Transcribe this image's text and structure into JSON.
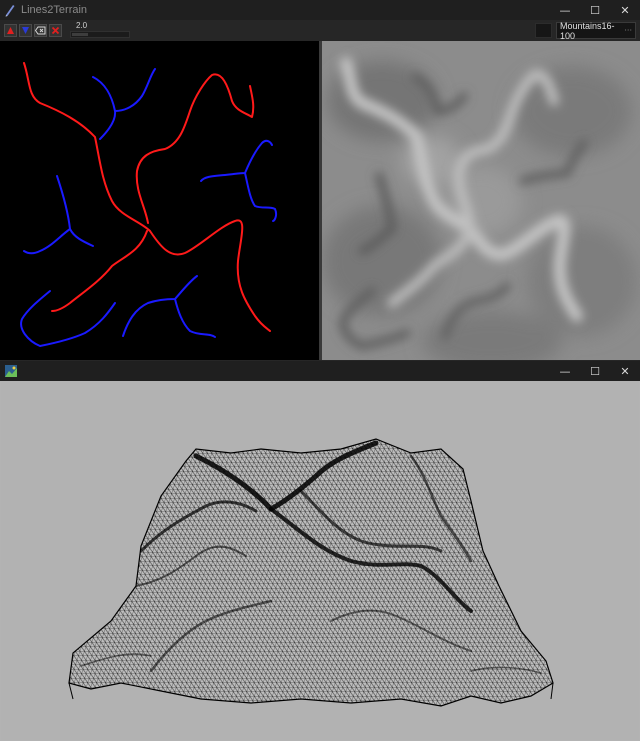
{
  "window1": {
    "title": "Lines2Terrain",
    "controls": {
      "minimize": "—",
      "maximize": "☐",
      "close": "✕"
    },
    "toolbar": {
      "tools": [
        {
          "name": "mountain-ridge-tool",
          "icon": "triangle-up-icon",
          "color": "#e02020"
        },
        {
          "name": "river-valley-tool",
          "icon": "triangle-down-icon",
          "color": "#2a3ad8"
        },
        {
          "name": "erase-tool",
          "icon": "eraser-icon",
          "color": "#d8d8d8"
        },
        {
          "name": "clear-tool",
          "icon": "close-icon",
          "color": "#e02020"
        }
      ],
      "brush_value": "2.0",
      "brush_fraction": 0.28,
      "preset": "Mountains16-100"
    },
    "line_colors": {
      "ridge": "#ff1a1a",
      "valley": "#1a1aff"
    }
  },
  "window2": {
    "title": "",
    "controls": {
      "minimize": "—",
      "maximize": "☐",
      "close": "✕"
    },
    "background": "#b2b2b2",
    "mesh_color": "#000000"
  }
}
